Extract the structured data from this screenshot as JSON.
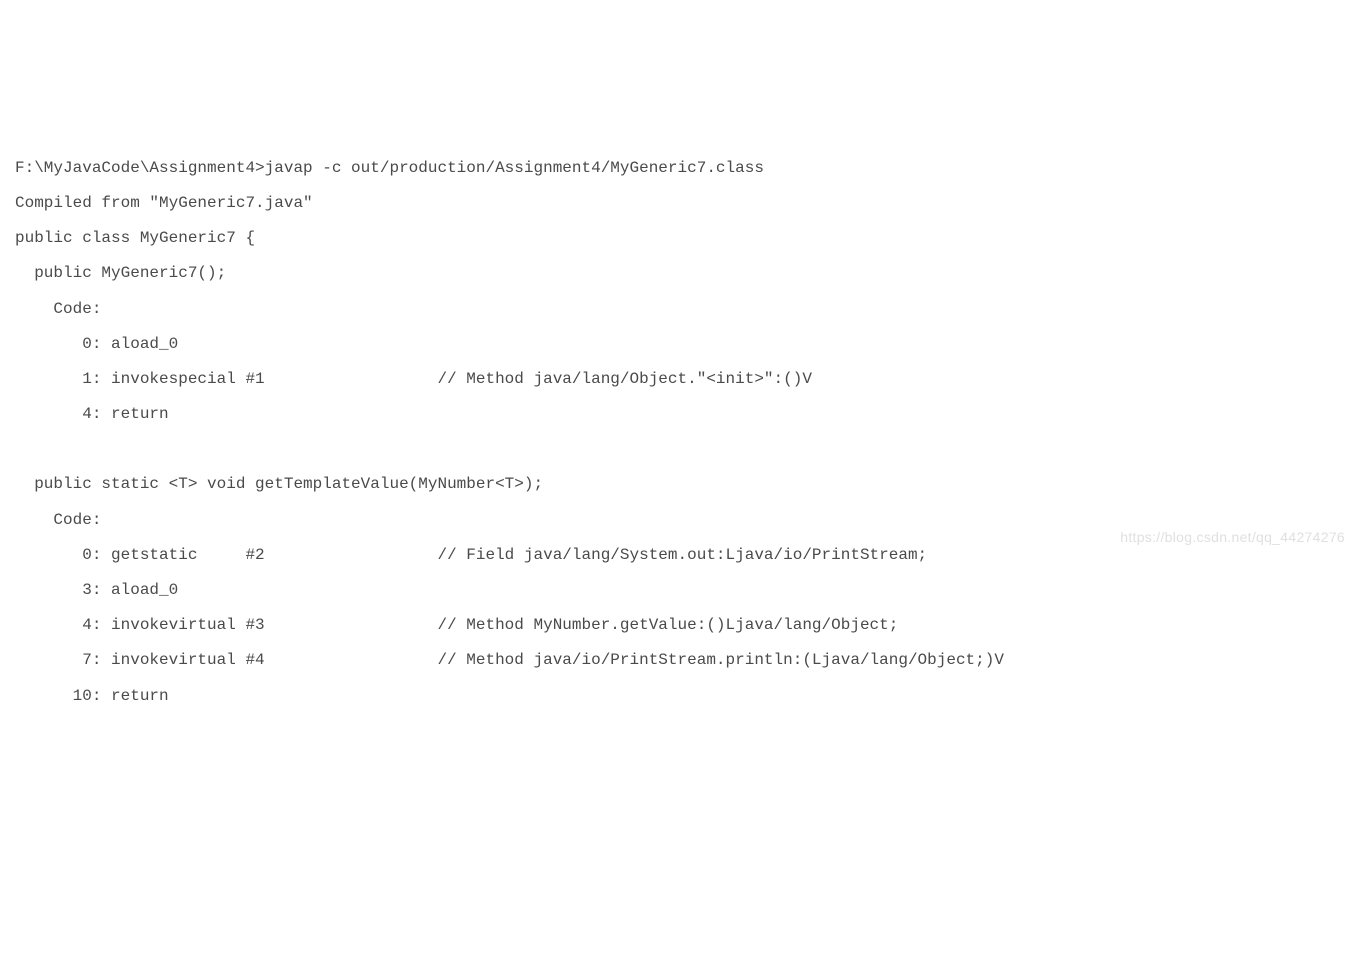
{
  "lines": [
    "F:\\MyJavaCode\\Assignment4>javap -c out/production/Assignment4/MyGeneric7.class",
    "Compiled from \"MyGeneric7.java\"",
    "public class MyGeneric7 {",
    "  public MyGeneric7();",
    "    Code:",
    "       0: aload_0",
    "       1: invokespecial #1                  // Method java/lang/Object.\"<init>\":()V",
    "       4: return",
    "",
    "  public static <T> void getTemplateValue(MyNumber<T>);",
    "    Code:",
    "       0: getstatic     #2                  // Field java/lang/System.out:Ljava/io/PrintStream;",
    "       3: aload_0",
    "       4: invokevirtual #3                  // Method MyNumber.getValue:()Ljava/lang/Object;",
    "       7: invokevirtual #4                  // Method java/io/PrintStream.println:(Ljava/lang/Object;)V",
    "      10: return"
  ],
  "watermark": "https://blog.csdn.net/qq_44274276"
}
